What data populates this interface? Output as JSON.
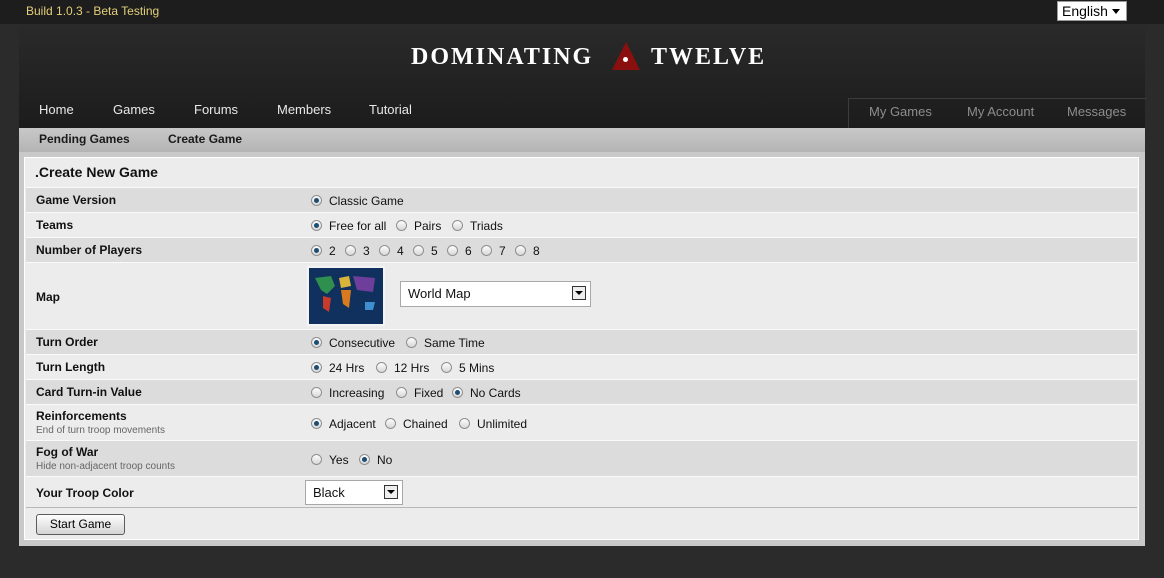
{
  "build": "Build 1.0.3 - Beta Testing",
  "language": "English",
  "logo": {
    "left": "DOMINATING",
    "right": "TWELVE"
  },
  "nav": {
    "home": "Home",
    "games": "Games",
    "forums": "Forums",
    "members": "Members",
    "tutorial": "Tutorial"
  },
  "user_nav": {
    "my_games": "My Games",
    "my_account": "My Account",
    "messages": "Messages"
  },
  "subnav": {
    "pending": "Pending Games",
    "create": "Create Game"
  },
  "form": {
    "title": ".Create New Game",
    "game_version": {
      "label": "Game Version",
      "options": [
        "Classic Game"
      ],
      "selected": 0
    },
    "teams": {
      "label": "Teams",
      "options": [
        "Free for all",
        "Pairs",
        "Triads"
      ],
      "selected": 0
    },
    "players": {
      "label": "Number of Players",
      "options": [
        "2",
        "3",
        "4",
        "5",
        "6",
        "7",
        "8"
      ],
      "selected": 0
    },
    "map": {
      "label": "Map",
      "value": "World Map"
    },
    "turn_order": {
      "label": "Turn Order",
      "options": [
        "Consecutive",
        "Same Time"
      ],
      "selected": 0
    },
    "turn_length": {
      "label": "Turn Length",
      "options": [
        "24 Hrs",
        "12 Hrs",
        "5 Mins"
      ],
      "selected": 0
    },
    "card_value": {
      "label": "Card Turn-in Value",
      "options": [
        "Increasing",
        "Fixed",
        "No Cards"
      ],
      "selected": 2
    },
    "reinforcements": {
      "label": "Reinforcements",
      "sublabel": "End of turn troop movements",
      "options": [
        "Adjacent",
        "Chained",
        "Unlimited"
      ],
      "selected": 0
    },
    "fog": {
      "label": "Fog of War",
      "sublabel": "Hide non-adjacent troop counts",
      "options": [
        "Yes",
        "No"
      ],
      "selected": 1
    },
    "troop_color": {
      "label": "Your Troop Color",
      "value": "Black"
    },
    "start_label": "Start Game"
  },
  "colors": {
    "accent": "#1e4d72",
    "build_text": "#e3cf7a",
    "logo_triangle": "#8a1010"
  }
}
